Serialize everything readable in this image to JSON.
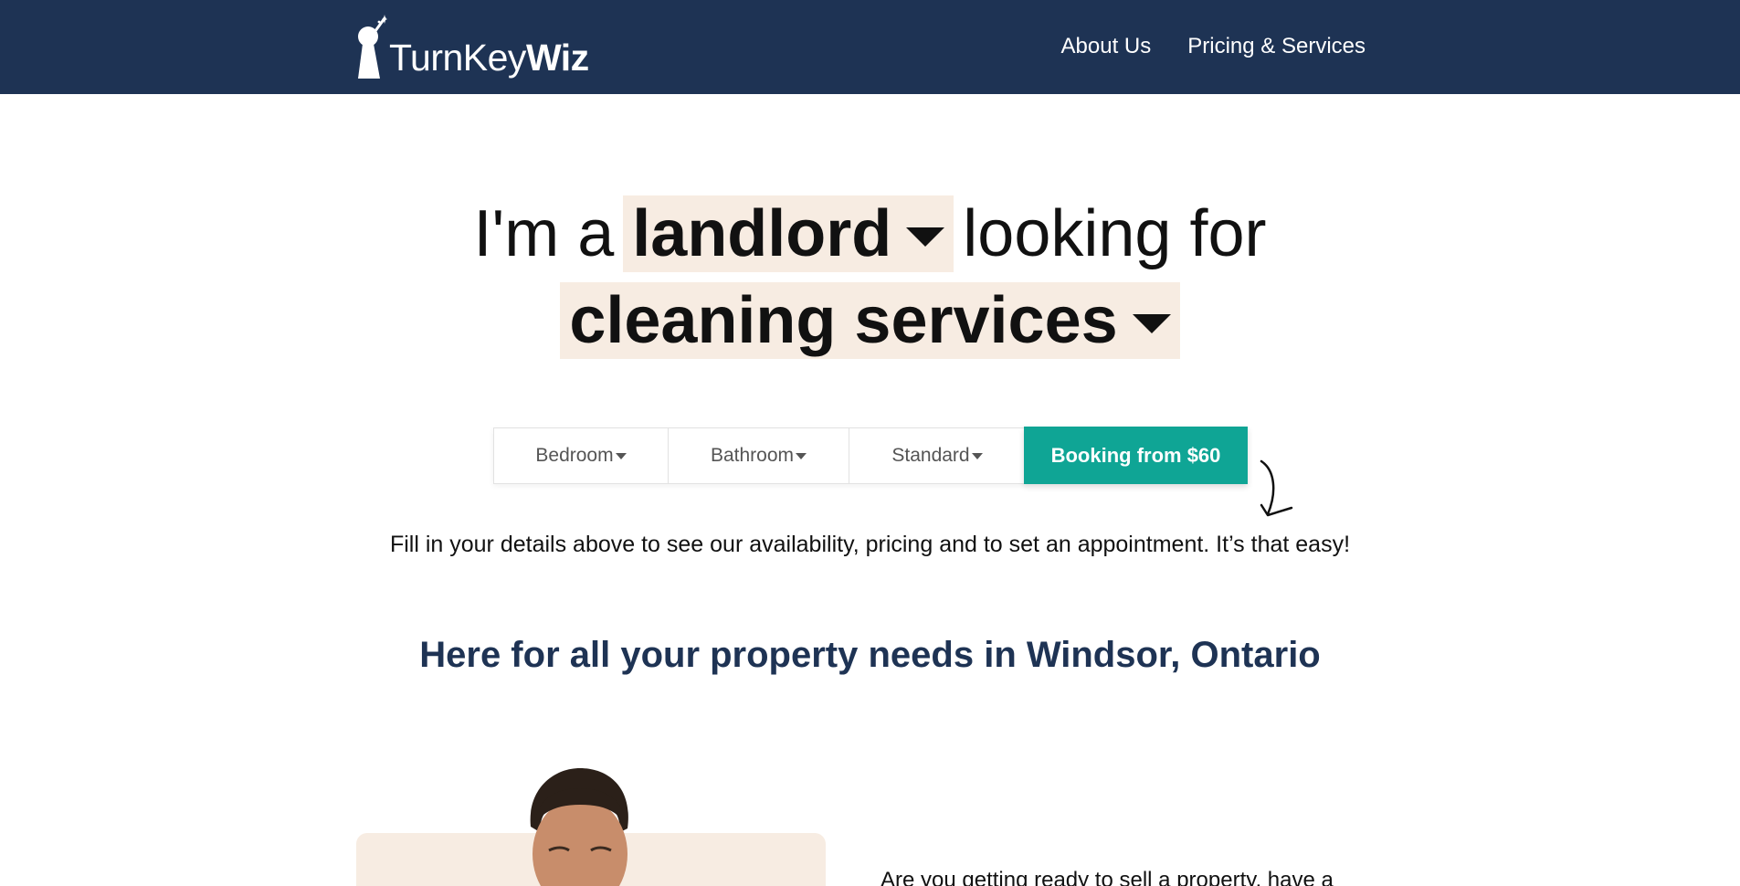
{
  "header": {
    "logo": {
      "part1": "TurnKey",
      "part2": "Wiz"
    },
    "nav": [
      {
        "label": "About Us"
      },
      {
        "label": "Pricing & Services"
      }
    ]
  },
  "hero": {
    "prefix": "I'm a",
    "role": "landlord",
    "connector": "looking for",
    "service": "cleaning services"
  },
  "booking": {
    "bedroom": "Bedroom",
    "bathroom": "Bathroom",
    "plan": "Standard",
    "cta": "Booking from $60"
  },
  "helper_text": "Fill in your details above to see our availability, pricing and to set an appointment. It’s that easy!",
  "section_title": "Here for all your property needs in Windsor, Ontario",
  "intro_text": "Are you getting ready to sell a property, have a",
  "colors": {
    "header_bg": "#1e3354",
    "accent": "#0fa595",
    "picker_bg": "#f7ece2",
    "title": "#1e3354"
  }
}
